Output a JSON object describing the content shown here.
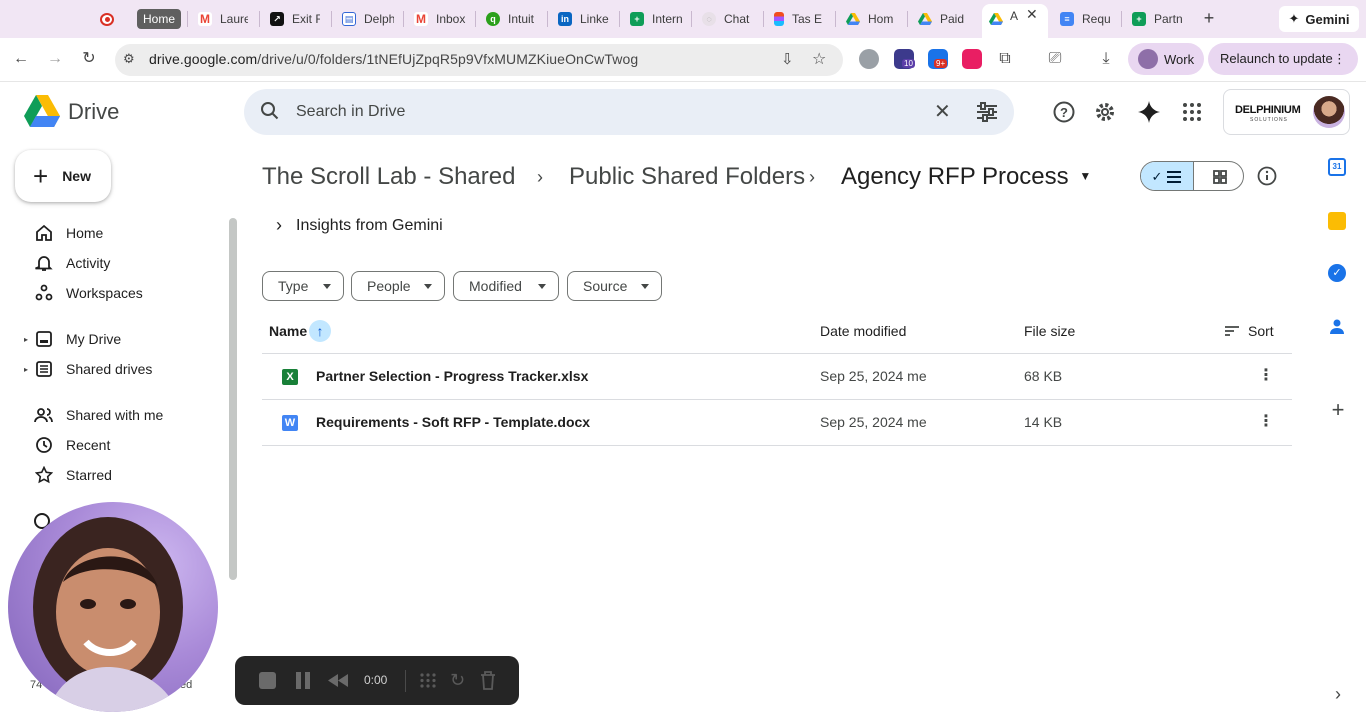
{
  "browser": {
    "tabs": [
      {
        "label": "Home",
        "icon": "camera-record-icon"
      },
      {
        "label": "Laure",
        "icon": "gmail-icon"
      },
      {
        "label": "Exit F",
        "icon": "arrow-box-icon"
      },
      {
        "label": "Delph",
        "icon": "notes-icon"
      },
      {
        "label": "Inbox",
        "icon": "gmail-icon"
      },
      {
        "label": "Intuit",
        "icon": "intuit-icon"
      },
      {
        "label": "Linke",
        "icon": "linkedin-icon"
      },
      {
        "label": "Intern",
        "icon": "sheets-icon"
      },
      {
        "label": "Chat",
        "icon": "chat-icon"
      },
      {
        "label": "Tas E",
        "icon": "figma-icon"
      },
      {
        "label": "Hom",
        "icon": "drive-icon"
      },
      {
        "label": "Paid",
        "icon": "drive-icon"
      },
      {
        "label": "A",
        "icon": "drive-icon"
      },
      {
        "label": "Requ",
        "icon": "docs-icon"
      },
      {
        "label": "Partn",
        "icon": "sheets-icon"
      }
    ],
    "gemini_label": "Gemini",
    "url_host": "drive.google.com",
    "url_path": "/drive/u/0/folders/1tNEfUjZpqR5p9VfxMUMZKiueOnCwTwog",
    "profile_label": "Work",
    "relaunch_label": "Relaunch to update",
    "extension_badges": [
      "10",
      "9+"
    ]
  },
  "drive": {
    "app_name": "Drive",
    "search_placeholder": "Search in Drive",
    "account_brand": "DELPHINIUM",
    "account_brand_sub": "SOLUTIONS",
    "new_label": "New",
    "nav": [
      {
        "label": "Home",
        "icon": "home-icon"
      },
      {
        "label": "Activity",
        "icon": "bell-icon"
      },
      {
        "label": "Workspaces",
        "icon": "workspaces-icon"
      },
      {
        "label": "My Drive",
        "icon": "my-drive-icon"
      },
      {
        "label": "Shared drives",
        "icon": "shared-drives-icon"
      },
      {
        "label": "Shared with me",
        "icon": "people-icon"
      },
      {
        "label": "Recent",
        "icon": "clock-icon"
      },
      {
        "label": "Starred",
        "icon": "star-icon"
      }
    ],
    "breadcrumb": [
      "The Scroll Lab - Shared...",
      "Public Shared Folders",
      "Agency RFP Process"
    ],
    "insights_label": "Insights from Gemini",
    "filters": [
      "Type",
      "People",
      "Modified",
      "Source"
    ],
    "columns": {
      "name": "Name",
      "date": "Date modified",
      "size": "File size",
      "sort": "Sort"
    },
    "files": [
      {
        "name": "Partner Selection - Progress Tracker.xlsx",
        "type": "xlsx",
        "type_letter": "X",
        "color": "#188038",
        "date": "Sep 25, 2024 me",
        "size": "68 KB"
      },
      {
        "name": "Requirements - Soft RFP - Template.docx",
        "type": "docx",
        "type_letter": "W",
        "color": "#4285f4",
        "date": "Sep 25, 2024 me",
        "size": "14 KB"
      }
    ],
    "storage_fragment_left": "74",
    "storage_fragment_right": "ed"
  },
  "recorder": {
    "time": "0:00"
  },
  "colors": {
    "accent": "#0b57d0",
    "selected_bg": "#c2e7ff",
    "search_bg": "#e9eef6",
    "tabstrip_bg": "#f1e6f4"
  }
}
